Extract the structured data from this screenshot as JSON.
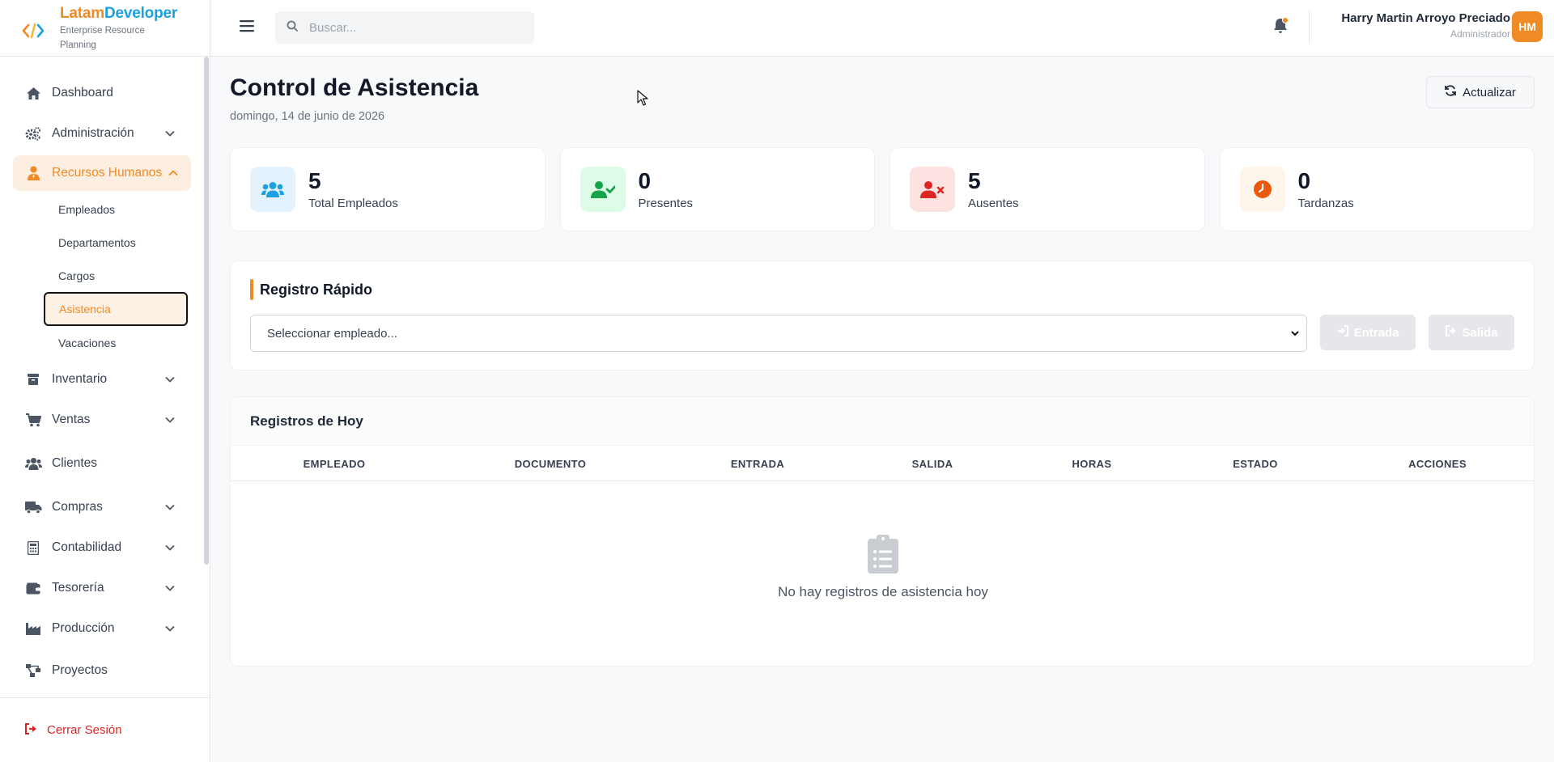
{
  "brand": {
    "name_part1": "Latam",
    "name_part2": "Developer",
    "subtitle": "Enterprise Resource Planning"
  },
  "sidebar": {
    "items": [
      {
        "label": "Dashboard",
        "icon": "home-icon",
        "expandable": false
      },
      {
        "label": "Administración",
        "icon": "cogs-icon",
        "expandable": true
      },
      {
        "label": "Recursos Humanos",
        "icon": "user-tie-icon",
        "expandable": true,
        "active": true,
        "children": [
          "Empleados",
          "Departamentos",
          "Cargos",
          "Asistencia",
          "Vacaciones"
        ],
        "current_child": "Asistencia"
      },
      {
        "label": "Inventario",
        "icon": "boxes-icon",
        "expandable": true
      },
      {
        "label": "Ventas",
        "icon": "cart-icon",
        "expandable": true
      },
      {
        "label": "Clientes",
        "icon": "users-icon",
        "expandable": false
      },
      {
        "label": "Compras",
        "icon": "truck-icon",
        "expandable": true
      },
      {
        "label": "Contabilidad",
        "icon": "calculator-icon",
        "expandable": true
      },
      {
        "label": "Tesorería",
        "icon": "wallet-icon",
        "expandable": true
      },
      {
        "label": "Producción",
        "icon": "industry-icon",
        "expandable": true
      },
      {
        "label": "Proyectos",
        "icon": "project-diagram-icon",
        "expandable": false
      }
    ],
    "logout_label": "Cerrar Sesión"
  },
  "topbar": {
    "search_placeholder": "Buscar...",
    "user_name": "Harry Martin Arroyo Preciado",
    "user_role": "Administrador",
    "avatar_initials": "HM"
  },
  "page": {
    "title": "Control de Asistencia",
    "date": "domingo, 14 de junio de 2026",
    "refresh_label": "Actualizar"
  },
  "stats": [
    {
      "value": "5",
      "label": "Total Empleados",
      "icon": "users-icon",
      "color": "#1ba0e2",
      "bg": "#e3f2fc"
    },
    {
      "value": "0",
      "label": "Presentes",
      "icon": "user-check-icon",
      "color": "#16a34a",
      "bg": "#dcfce7"
    },
    {
      "value": "5",
      "label": "Ausentes",
      "icon": "user-times-icon",
      "color": "#dc2626",
      "bg": "#fde2e2"
    },
    {
      "value": "0",
      "label": "Tardanzas",
      "icon": "clock-icon",
      "color": "#ea580c",
      "bg": "#fef5eb"
    }
  ],
  "quick": {
    "title": "Registro Rápido",
    "select_placeholder": "Seleccionar empleado...",
    "entry_label": "Entrada",
    "exit_label": "Salida"
  },
  "records": {
    "title": "Registros de Hoy",
    "columns": [
      "EMPLEADO",
      "DOCUMENTO",
      "ENTRADA",
      "SALIDA",
      "HORAS",
      "ESTADO",
      "ACCIONES"
    ],
    "empty_message": "No hay registros de asistencia hoy"
  },
  "colors": {
    "accent": "#f08a24",
    "brand_blue": "#1ba0e2",
    "danger": "#dc2626"
  }
}
